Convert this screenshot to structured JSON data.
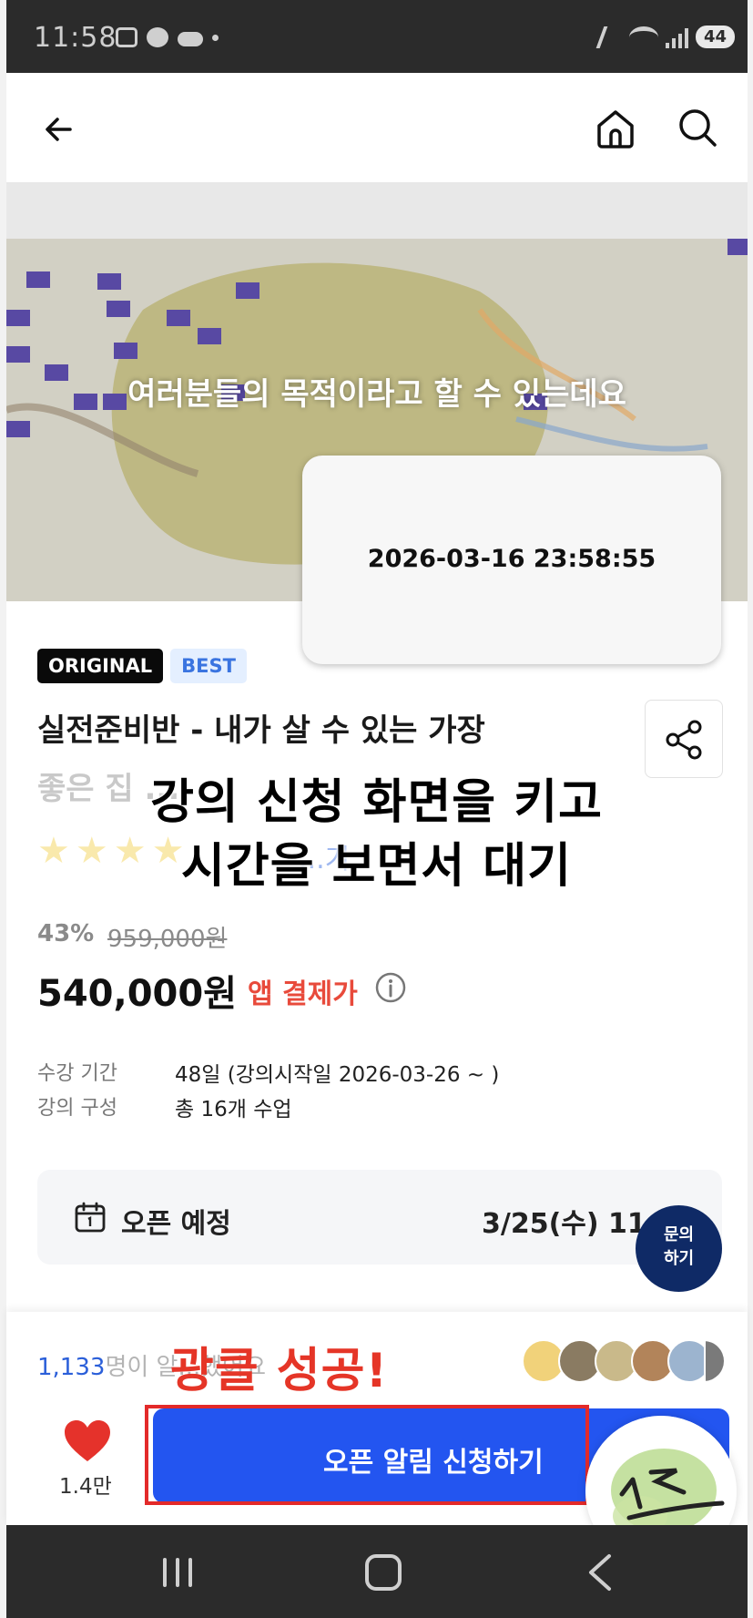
{
  "status_bar": {
    "time": "11:58",
    "battery": "44"
  },
  "video": {
    "caption": "여러분들의 목적이라고 할 수 있는데요",
    "timestamp": "2026-03-16 23:58:55"
  },
  "badges": {
    "original": "ORIGINAL",
    "best": "BEST"
  },
  "course": {
    "title_line1": "실전준비반 - 내가 살 수 있는 가장",
    "title_line2": "좋은 집 ...",
    "reviews_link": "...기"
  },
  "overlay": {
    "line1": "강의 신청 화면을 키고",
    "line2": "시간을 보면서 대기"
  },
  "pricing": {
    "discount": "43%",
    "original_price": "959,000원",
    "price": "540,000원",
    "app_price_label": "앱 결제가"
  },
  "meta": {
    "period_label": "수강 기간",
    "period_value": "48일 (강의시작일 2026-03-26 ~ )",
    "composition_label": "강의 구성",
    "composition_value": "총 16개 수업"
  },
  "open_schedule": {
    "label": "오픈 예정",
    "date": "3/25(수) 11:..."
  },
  "inquiry": {
    "line1": "문의",
    "line2": "하기"
  },
  "bottom": {
    "applicants_count": "1,133",
    "applicants_suffix": "명이 알...했어요",
    "success_text": "광클 성공!",
    "like_count": "1.4만",
    "cta_label": "오픈 알림 신청하기"
  },
  "colors": {
    "accent_blue": "#2355f0",
    "price_red": "#e84a3b",
    "success_red": "#e53527",
    "inquiry_navy": "#0f2a66"
  }
}
